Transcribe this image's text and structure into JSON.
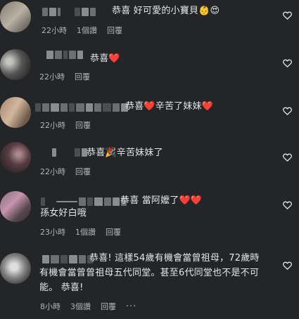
{
  "comments": [
    {
      "text": "恭喜 好可愛的小寶貝👶😍",
      "time": "22小時",
      "likes": "1個讚",
      "reply": "回覆"
    },
    {
      "text": "恭喜❤️",
      "time": "22小時",
      "reply": "回覆"
    },
    {
      "text": "恭喜❤️辛苦了妹妹❤️",
      "time": "22小時",
      "reply": "回覆"
    },
    {
      "text": "恭喜🎉辛苦妹妹了",
      "time": "22小時",
      "reply": "回覆"
    },
    {
      "text_line1": "恭喜 當阿嬤了❤️❤️",
      "text_line2": "孫女好白哦",
      "time": "23小時",
      "likes": "1個讚",
      "reply": "回覆"
    },
    {
      "text_line1": "恭喜! 這樣54歲有機會當曾祖母，72歲時",
      "text_line2": "有機會當曾曾祖母五代同堂。甚至6代同堂也不是不可",
      "text_line3": "能。 恭喜!",
      "time": "8小時",
      "likes": "3個讚",
      "reply": "回覆",
      "more": "···"
    }
  ],
  "icons": {
    "like": "heart-outline-icon"
  },
  "colors": {
    "background": "#242526",
    "text": "#e4e6eb",
    "meta": "#b0b3b8"
  }
}
